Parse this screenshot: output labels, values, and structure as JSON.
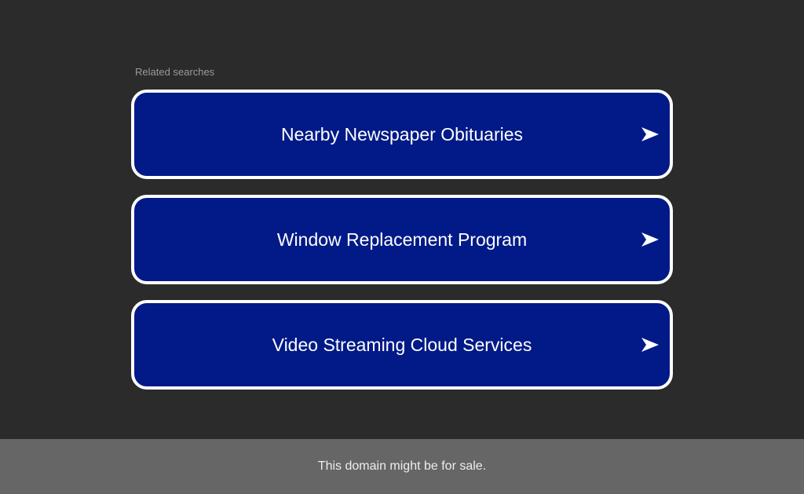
{
  "related": {
    "label": "Related searches",
    "items": [
      {
        "label": "Nearby Newspaper Obituaries",
        "icon": "arrow-right-icon"
      },
      {
        "label": "Window Replacement Program",
        "icon": "arrow-right-icon"
      },
      {
        "label": "Video Streaming Cloud Services",
        "icon": "arrow-right-icon"
      }
    ]
  },
  "footer": {
    "text": "This domain might be for sale."
  },
  "colors": {
    "background": "#2b2b2b",
    "button": "#011a87",
    "footer": "#666666"
  }
}
